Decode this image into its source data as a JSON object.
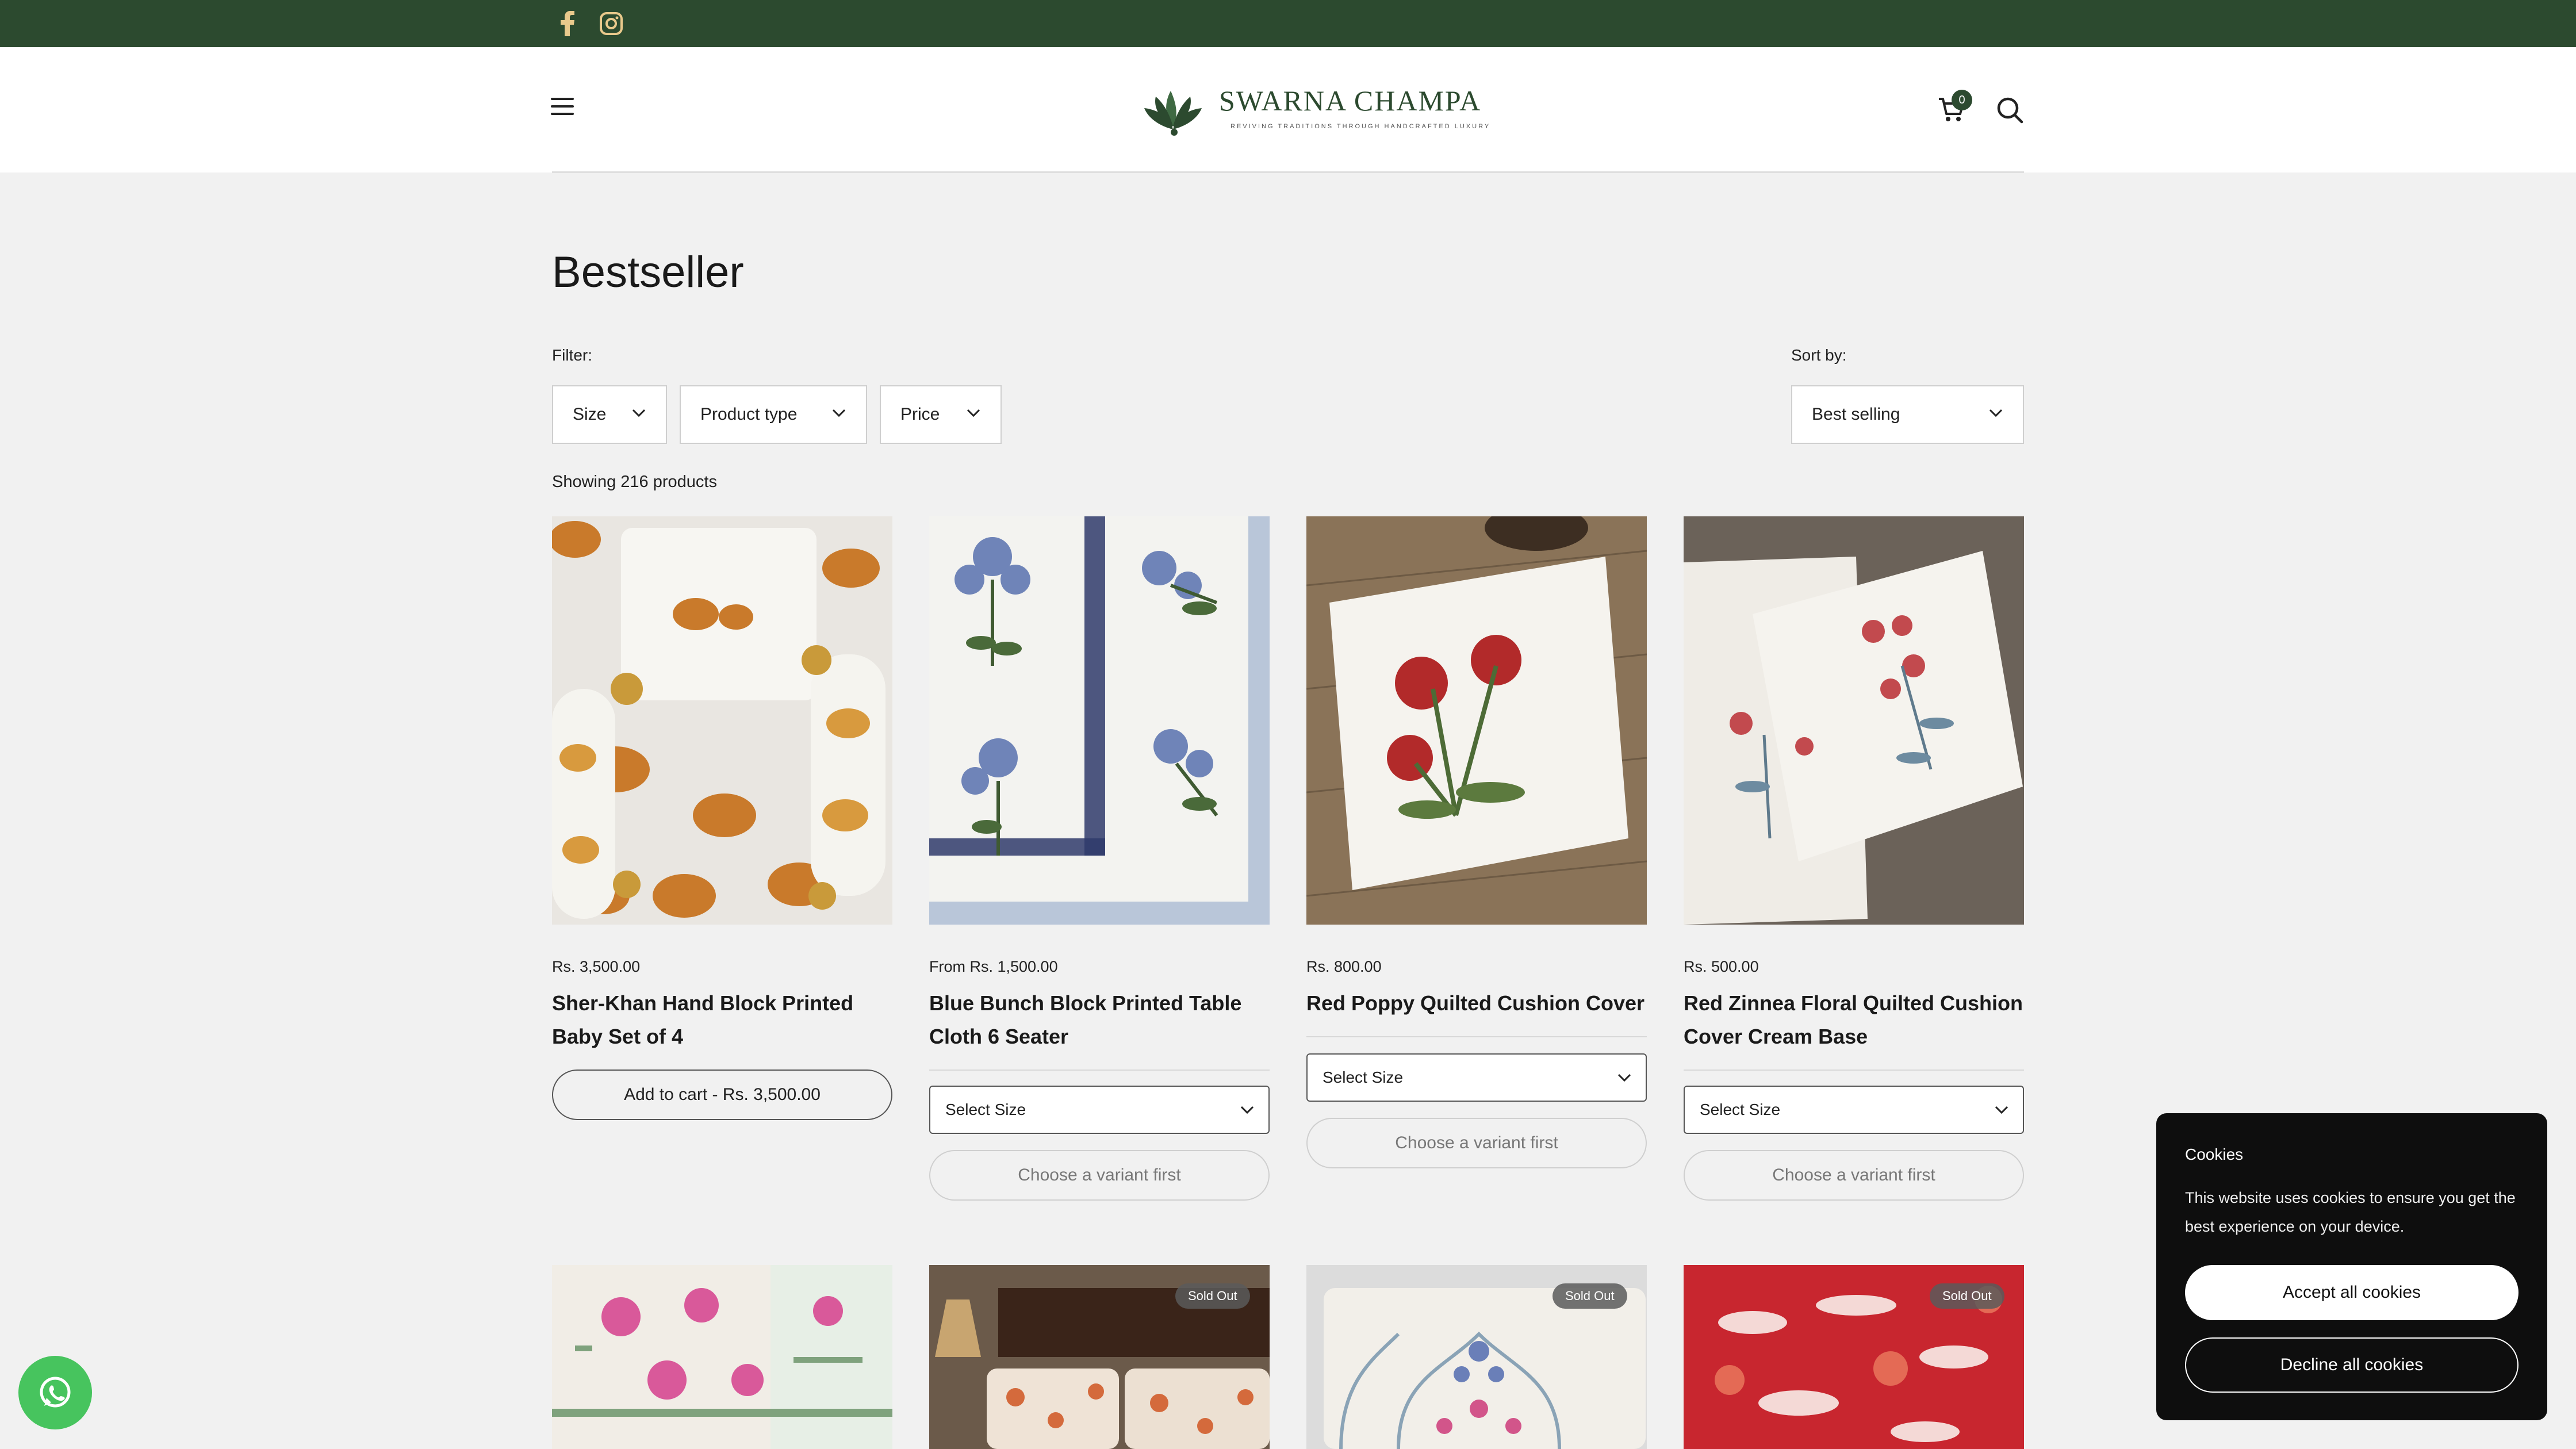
{
  "social": {
    "icons": [
      "facebook-icon",
      "instagram-icon"
    ]
  },
  "header": {
    "logo_name": "SWARNA CHAMPA",
    "logo_tagline": "REVIVING TRADITIONS THROUGH HANDCRAFTED LUXURY",
    "cart_count": "0"
  },
  "page": {
    "title": "Bestseller"
  },
  "filters": {
    "label": "Filter:",
    "buttons": [
      "Size",
      "Product type",
      "Price"
    ],
    "sort_label": "Sort by:",
    "sort_value": "Best selling",
    "showing": "Showing 216 products"
  },
  "products": [
    {
      "price": "Rs. 3,500.00",
      "title": "Sher-Khan Hand Block Printed Baby Set of 4",
      "action": "Add to cart - Rs. 3,500.00"
    },
    {
      "price": "From Rs. 1,500.00",
      "title": "Blue Bunch Block Printed Table Cloth 6 Seater",
      "select": "Select Size",
      "action": "Choose a variant first"
    },
    {
      "price": "Rs. 800.00",
      "title": "Red Poppy Quilted Cushion Cover",
      "select": "Select Size",
      "action": "Choose a variant first"
    },
    {
      "price": "Rs. 500.00",
      "title": "Red Zinnea Floral Quilted Cushion Cover Cream Base",
      "select": "Select Size",
      "action": "Choose a variant first"
    }
  ],
  "row2": {
    "badge": "Sold Out"
  },
  "cookie": {
    "title": "Cookies",
    "text": "This website uses cookies to ensure you get the best experience on your device.",
    "accept": "Accept all cookies",
    "decline": "Decline all cookies"
  },
  "colors": {
    "brand": "#2c4a2f",
    "whatsapp": "#47c45e",
    "background": "#f1f1f1"
  }
}
